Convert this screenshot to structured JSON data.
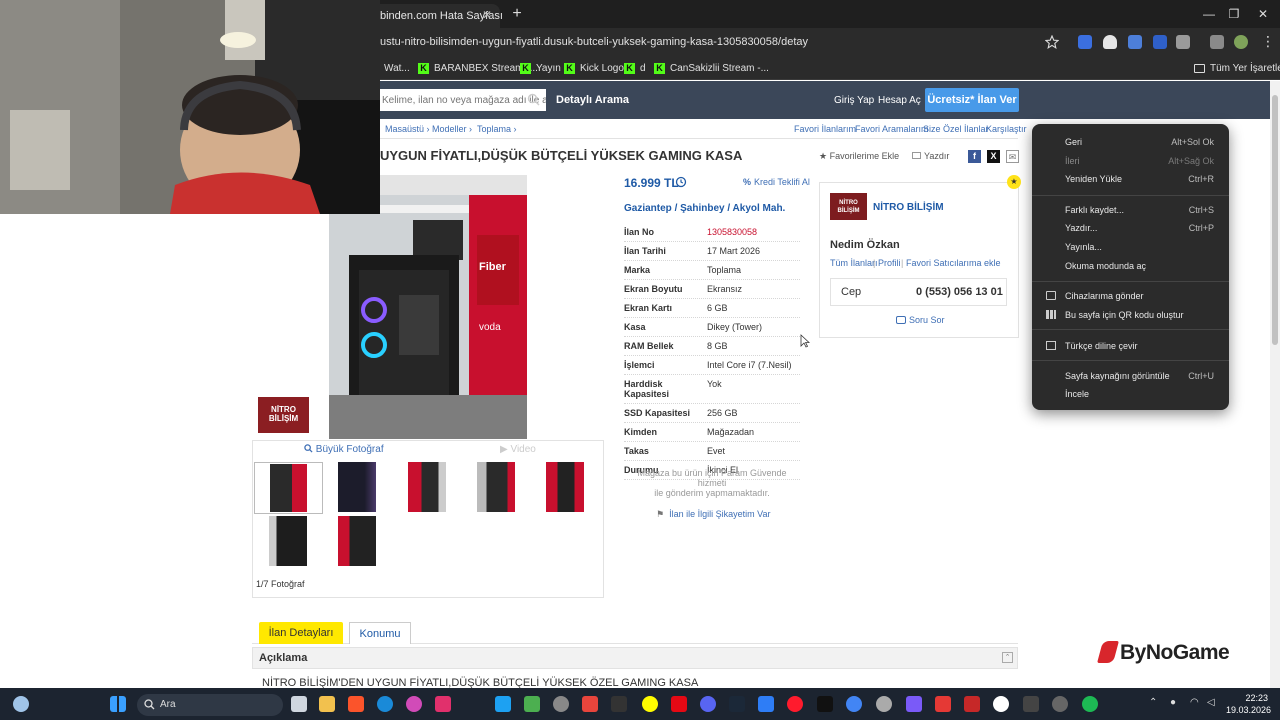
{
  "browser": {
    "tab_title": "binden.com Hata Sayfası",
    "tab_close": "✕",
    "new_tab": "+",
    "url": "ustu-nitro-bilisimden-uygun-fiyatli.dusuk-butceli-yuksek-gaming-kasa-1305830058/detay",
    "window_controls": {
      "minimize": "—",
      "maximize": "❐",
      "close": "✕"
    },
    "bookmarks": [
      {
        "label": "Wat..."
      },
      {
        "label": "BARANBEX Stream -..."
      },
      {
        "label": "Yayın"
      },
      {
        "label": "Kick Logo"
      },
      {
        "label": "d"
      },
      {
        "label": "CanSakizlii Stream -..."
      }
    ],
    "all_bookmarks": "Tüm Yer İşaretleri"
  },
  "header": {
    "search_placeholder": "Kelime, ilan no veya mağaza adı ile ara",
    "detailed_search": "Detaylı Arama",
    "login": "Giriş Yap",
    "register": "Hesap Aç",
    "post_ad": "Ücretsiz* İlan Ver"
  },
  "breadcrumb": {
    "items": [
      "Masaüstü ›",
      "Modeller ›",
      "Toplama ›"
    ],
    "top_links": [
      "Favori İlanlarım",
      "Favori Aramalarım",
      "Size Özel İlanlar",
      "Karşılaştır"
    ]
  },
  "listing": {
    "title": "UYGUN FİYATLI,DÜŞÜK BÜTÇELİ YÜKSEK GAMING KASA",
    "fav_add": "★ Favorilerime Ekle",
    "print": "Yazdır",
    "price": "16.999 TL",
    "credit": "Kredi Teklifi Al",
    "location": "Gaziantep  /  Şahinbey  /  Akyol Mah.",
    "big_photo": "Büyük Fotoğraf",
    "video": "Video",
    "photo_count": "1/7 Fotoğraf",
    "safe_pay_line1": "Mağaza bu ürün için Param Güvende hizmeti",
    "safe_pay_line2": "ile gönderim yapmamaktadır.",
    "complaint": "İlan ile İlgili Şikayetim Var",
    "details": [
      {
        "label": "İlan No",
        "value": "1305830058"
      },
      {
        "label": "İlan Tarihi",
        "value": "17 Mart 2026"
      },
      {
        "label": "Marka",
        "value": "Toplama"
      },
      {
        "label": "Ekran Boyutu",
        "value": "Ekransız"
      },
      {
        "label": "Ekran Kartı",
        "value": "6 GB"
      },
      {
        "label": "Kasa",
        "value": "Dikey (Tower)"
      },
      {
        "label": "RAM Bellek",
        "value": "8 GB"
      },
      {
        "label": "İşlemci",
        "value": "Intel Core i7 (7.Nesil)"
      },
      {
        "label": "Harddisk Kapasitesi",
        "value": "Yok"
      },
      {
        "label": "SSD Kapasitesi",
        "value": "256 GB"
      },
      {
        "label": "Kimden",
        "value": "Mağazadan"
      },
      {
        "label": "Takas",
        "value": "Evet"
      },
      {
        "label": "Durumu",
        "value": "İkinci El"
      }
    ]
  },
  "seller": {
    "logo_text": "NİTRO BİLİŞİM",
    "store_name": "NİTRO BİLİŞİM",
    "person": "Nedim Özkan",
    "links": [
      "Tüm İlanları",
      "Profili",
      "Favori Satıcılarıma ekle"
    ],
    "phone_label": "Cep",
    "phone": "0 (553) 056 13 01",
    "ask": "Soru Sor"
  },
  "tabs": {
    "details": "İlan Detayları",
    "location": "Konumu"
  },
  "description": {
    "title": "Açıklama",
    "collapse": "⌃",
    "text": "NİTRO BİLİŞİM'DEN UYGUN FİYATLI,DÜŞÜK BÜTÇELİ YÜKSEK ÖZEL GAMING KASA"
  },
  "context_menu": {
    "items": [
      {
        "label": "Geri",
        "shortcut": "Alt+Sol Ok",
        "disabled": false
      },
      {
        "label": "İleri",
        "shortcut": "Alt+Sağ Ok",
        "disabled": true
      },
      {
        "label": "Yeniden Yükle",
        "shortcut": "Ctrl+R",
        "disabled": false
      },
      {
        "label": "Farklı kaydet...",
        "shortcut": "Ctrl+S",
        "disabled": false
      },
      {
        "label": "Yazdır...",
        "shortcut": "Ctrl+P",
        "disabled": false
      },
      {
        "label": "Yayınla...",
        "shortcut": "",
        "disabled": false
      },
      {
        "label": "Okuma modunda aç",
        "shortcut": "",
        "disabled": false
      },
      {
        "label": "Cihazlarıma gönder",
        "shortcut": "",
        "disabled": false
      },
      {
        "label": "Bu sayfa için QR kodu oluştur",
        "shortcut": "",
        "disabled": false
      },
      {
        "label": "Türkçe diline çevir",
        "shortcut": "",
        "disabled": false
      },
      {
        "label": "Sayfa kaynağını görüntüle",
        "shortcut": "Ctrl+U",
        "disabled": false
      },
      {
        "label": "İncele",
        "shortcut": "",
        "disabled": false
      }
    ]
  },
  "overlay": {
    "brand": "ByNoGame"
  },
  "taskbar": {
    "search": "Ara",
    "time": "22:23",
    "date": "19.03.2026"
  },
  "colors": {
    "header_bg": "#3b4759",
    "accent_blue": "#489ae9",
    "link": "#3f6fb5",
    "tab_yellow": "#ffe800",
    "id_red": "#c8102e"
  }
}
